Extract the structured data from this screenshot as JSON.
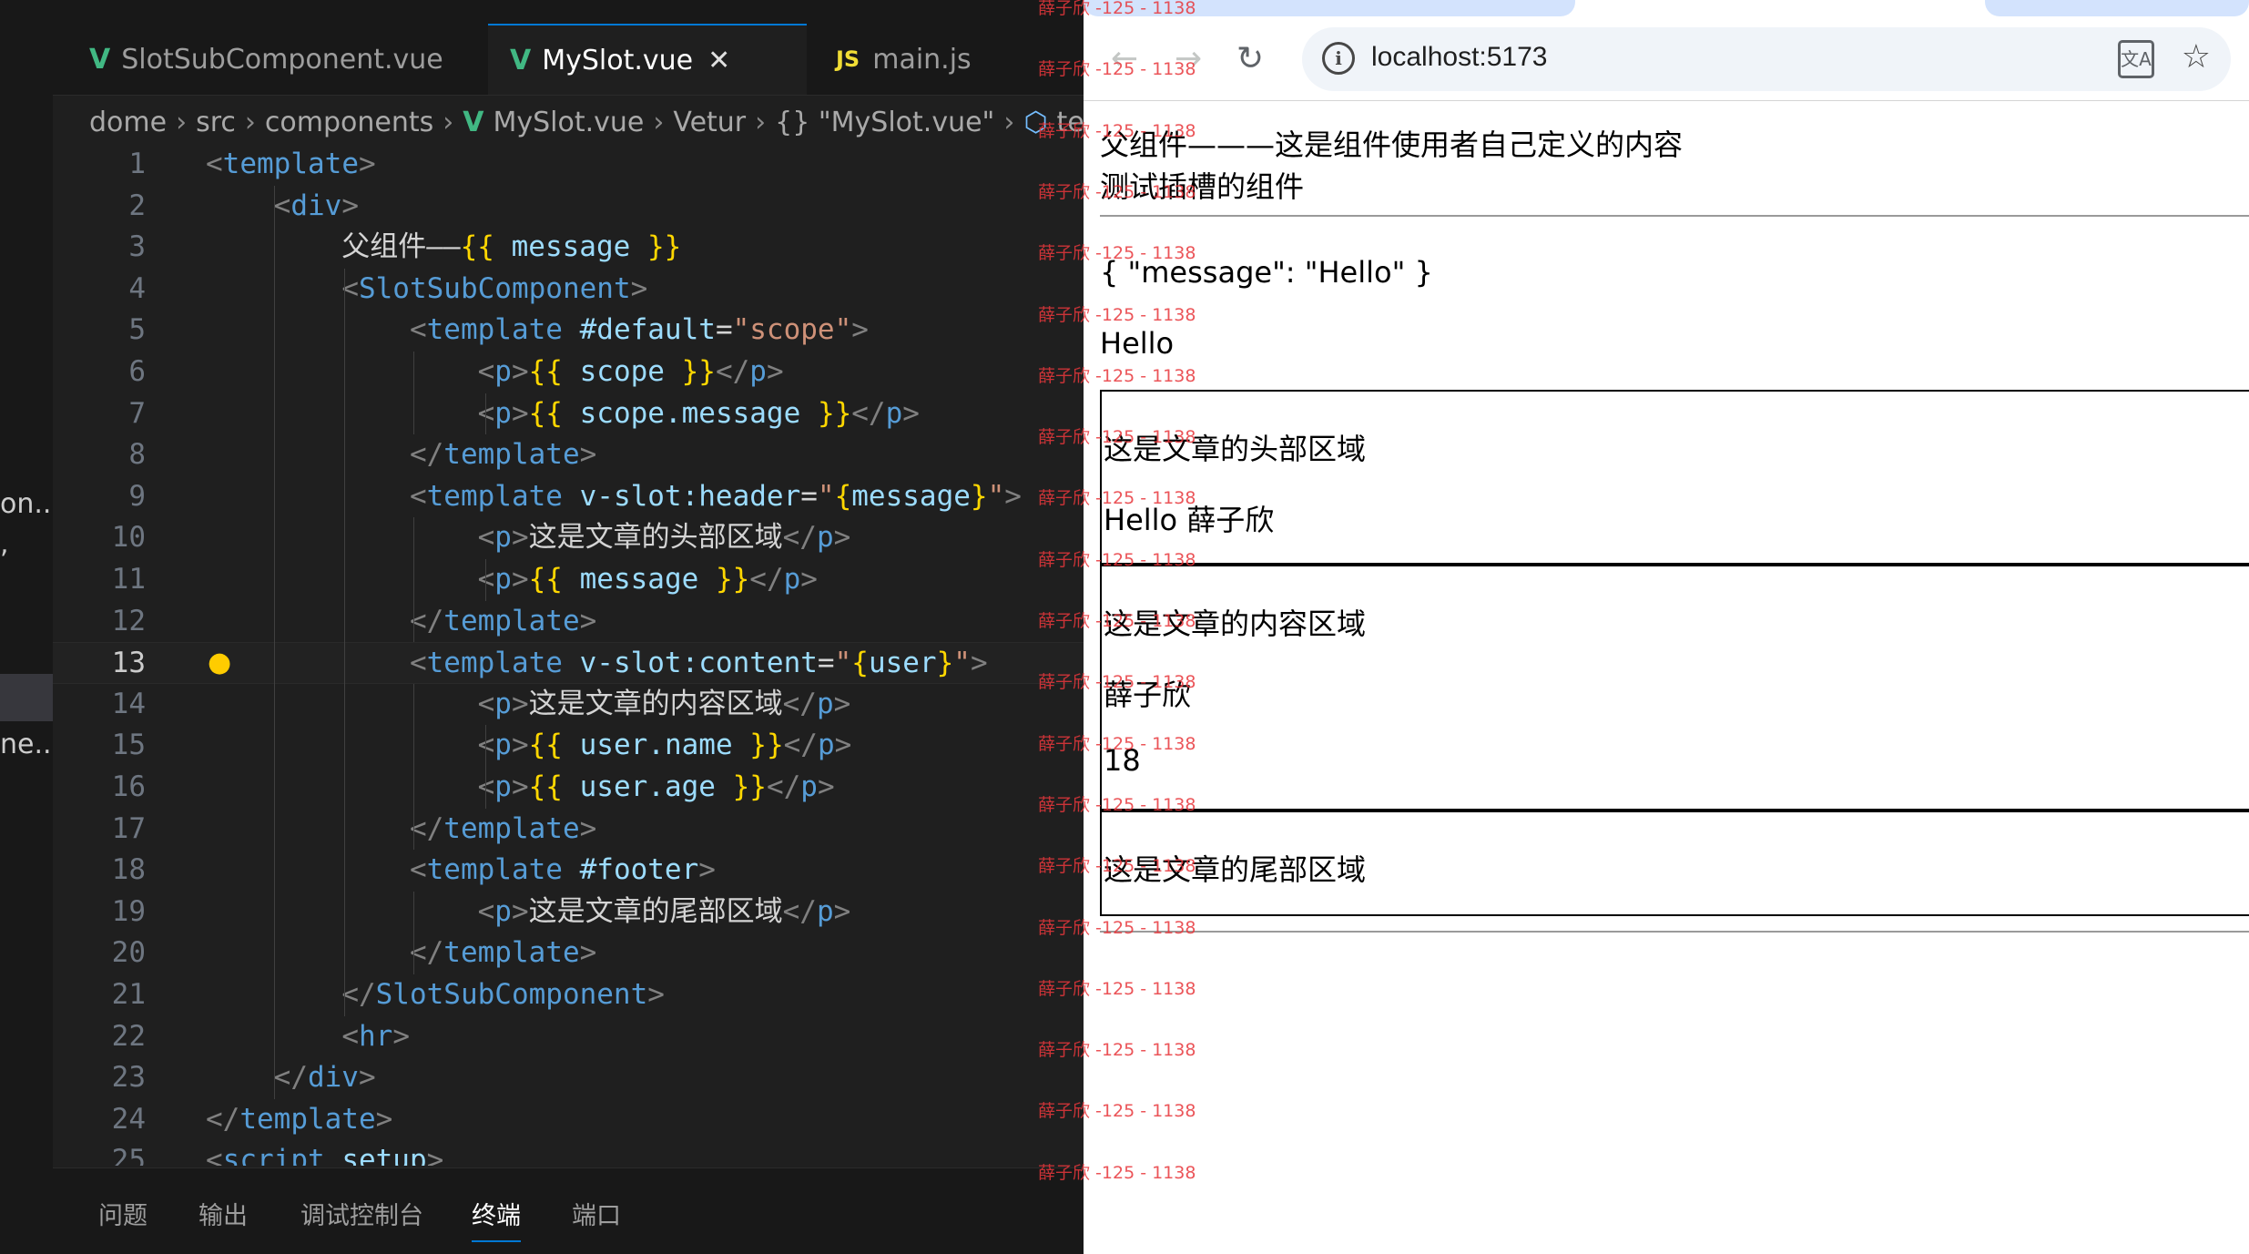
{
  "ide": {
    "activity_fragments": [
      "on...",
      ",",
      "ne..."
    ],
    "tabs": [
      {
        "label": "SlotSubComponent.vue",
        "kind": "vue",
        "active": false
      },
      {
        "label": "MySlot.vue",
        "kind": "vue",
        "active": true
      },
      {
        "label": "main.js",
        "kind": "js",
        "active": false
      }
    ],
    "tab_close_glyph": "✕",
    "breadcrumb": [
      "dome",
      "src",
      "components",
      "MySlot.vue",
      "Vetur",
      "{} \"MySlot.vue\"",
      "te..."
    ],
    "current_line": 13,
    "lines": [
      [
        [
          "p",
          "<"
        ],
        [
          "t",
          "template"
        ],
        [
          "p",
          ">"
        ]
      ],
      [
        [
          "x",
          "    "
        ],
        [
          "p",
          "<"
        ],
        [
          "t",
          "div"
        ],
        [
          "p",
          ">"
        ]
      ],
      [
        [
          "x",
          "        父组件——"
        ],
        [
          "b",
          "{{"
        ],
        [
          "v",
          " message "
        ],
        [
          "b",
          "}}"
        ]
      ],
      [
        [
          "x",
          "        "
        ],
        [
          "p",
          "<"
        ],
        [
          "t",
          "SlotSubComponent"
        ],
        [
          "p",
          ">"
        ]
      ],
      [
        [
          "x",
          "            "
        ],
        [
          "p",
          "<"
        ],
        [
          "t",
          "template"
        ],
        [
          "a",
          " #default"
        ],
        [
          "x",
          "="
        ],
        [
          "s",
          "\"scope\""
        ],
        [
          "p",
          ">"
        ]
      ],
      [
        [
          "x",
          "                "
        ],
        [
          "p",
          "<"
        ],
        [
          "t",
          "p"
        ],
        [
          "p",
          ">"
        ],
        [
          "b",
          "{{"
        ],
        [
          "v",
          " scope "
        ],
        [
          "b",
          "}}"
        ],
        [
          "p",
          "</"
        ],
        [
          "t",
          "p"
        ],
        [
          "p",
          ">"
        ]
      ],
      [
        [
          "x",
          "                "
        ],
        [
          "p",
          "<"
        ],
        [
          "t",
          "p"
        ],
        [
          "p",
          ">"
        ],
        [
          "b",
          "{{"
        ],
        [
          "v",
          " scope.message "
        ],
        [
          "b",
          "}}"
        ],
        [
          "p",
          "</"
        ],
        [
          "t",
          "p"
        ],
        [
          "p",
          ">"
        ]
      ],
      [
        [
          "x",
          "            "
        ],
        [
          "p",
          "</"
        ],
        [
          "t",
          "template"
        ],
        [
          "p",
          ">"
        ]
      ],
      [
        [
          "x",
          "            "
        ],
        [
          "p",
          "<"
        ],
        [
          "t",
          "template"
        ],
        [
          "a",
          " v-slot:header"
        ],
        [
          "x",
          "="
        ],
        [
          "s",
          "\""
        ],
        [
          "b",
          "{"
        ],
        [
          "v",
          "message"
        ],
        [
          "b",
          "}"
        ],
        [
          "s",
          "\""
        ],
        [
          "p",
          ">"
        ]
      ],
      [
        [
          "x",
          "                "
        ],
        [
          "p",
          "<"
        ],
        [
          "t",
          "p"
        ],
        [
          "p",
          ">"
        ],
        [
          "x",
          "这是文章的头部区域"
        ],
        [
          "p",
          "</"
        ],
        [
          "t",
          "p"
        ],
        [
          "p",
          ">"
        ]
      ],
      [
        [
          "x",
          "                "
        ],
        [
          "p",
          "<"
        ],
        [
          "t",
          "p"
        ],
        [
          "p",
          ">"
        ],
        [
          "b",
          "{{"
        ],
        [
          "v",
          " message "
        ],
        [
          "b",
          "}}"
        ],
        [
          "p",
          "</"
        ],
        [
          "t",
          "p"
        ],
        [
          "p",
          ">"
        ]
      ],
      [
        [
          "x",
          "            "
        ],
        [
          "p",
          "</"
        ],
        [
          "t",
          "template"
        ],
        [
          "p",
          ">"
        ]
      ],
      [
        [
          "x",
          "            "
        ],
        [
          "p",
          "<"
        ],
        [
          "t",
          "template"
        ],
        [
          "a",
          " v-slot:content"
        ],
        [
          "x",
          "="
        ],
        [
          "s",
          "\""
        ],
        [
          "b",
          "{"
        ],
        [
          "v",
          "user"
        ],
        [
          "b",
          "}"
        ],
        [
          "s",
          "\""
        ],
        [
          "p",
          ">"
        ]
      ],
      [
        [
          "x",
          "                "
        ],
        [
          "p",
          "<"
        ],
        [
          "t",
          "p"
        ],
        [
          "p",
          ">"
        ],
        [
          "x",
          "这是文章的内容区域"
        ],
        [
          "p",
          "</"
        ],
        [
          "t",
          "p"
        ],
        [
          "p",
          ">"
        ]
      ],
      [
        [
          "x",
          "                "
        ],
        [
          "p",
          "<"
        ],
        [
          "t",
          "p"
        ],
        [
          "p",
          ">"
        ],
        [
          "b",
          "{{"
        ],
        [
          "v",
          " user.name "
        ],
        [
          "b",
          "}}"
        ],
        [
          "p",
          "</"
        ],
        [
          "t",
          "p"
        ],
        [
          "p",
          ">"
        ]
      ],
      [
        [
          "x",
          "                "
        ],
        [
          "p",
          "<"
        ],
        [
          "t",
          "p"
        ],
        [
          "p",
          ">"
        ],
        [
          "b",
          "{{"
        ],
        [
          "v",
          " user.age "
        ],
        [
          "b",
          "}}"
        ],
        [
          "p",
          "</"
        ],
        [
          "t",
          "p"
        ],
        [
          "p",
          ">"
        ]
      ],
      [
        [
          "x",
          "            "
        ],
        [
          "p",
          "</"
        ],
        [
          "t",
          "template"
        ],
        [
          "p",
          ">"
        ]
      ],
      [
        [
          "x",
          "            "
        ],
        [
          "p",
          "<"
        ],
        [
          "t",
          "template"
        ],
        [
          "a",
          " #footer"
        ],
        [
          "p",
          ">"
        ]
      ],
      [
        [
          "x",
          "                "
        ],
        [
          "p",
          "<"
        ],
        [
          "t",
          "p"
        ],
        [
          "p",
          ">"
        ],
        [
          "x",
          "这是文章的尾部区域"
        ],
        [
          "p",
          "</"
        ],
        [
          "t",
          "p"
        ],
        [
          "p",
          ">"
        ]
      ],
      [
        [
          "x",
          "            "
        ],
        [
          "p",
          "</"
        ],
        [
          "t",
          "template"
        ],
        [
          "p",
          ">"
        ]
      ],
      [
        [
          "x",
          "        "
        ],
        [
          "p",
          "</"
        ],
        [
          "t",
          "SlotSubComponent"
        ],
        [
          "p",
          ">"
        ]
      ],
      [
        [
          "x",
          "        "
        ],
        [
          "p",
          "<"
        ],
        [
          "t",
          "hr"
        ],
        [
          "p",
          ">"
        ]
      ],
      [
        [
          "x",
          "    "
        ],
        [
          "p",
          "</"
        ],
        [
          "t",
          "div"
        ],
        [
          "p",
          ">"
        ]
      ],
      [
        [
          "p",
          "</"
        ],
        [
          "t",
          "template"
        ],
        [
          "p",
          ">"
        ]
      ],
      [
        [
          "p",
          "<"
        ],
        [
          "t",
          "script"
        ],
        [
          "a",
          " setup"
        ],
        [
          "p",
          ">"
        ]
      ]
    ],
    "panel_tabs": [
      {
        "label": "问题",
        "active": false
      },
      {
        "label": "输出",
        "active": false
      },
      {
        "label": "调试控制台",
        "active": false
      },
      {
        "label": "终端",
        "active": true
      },
      {
        "label": "端口",
        "active": false
      }
    ]
  },
  "browser": {
    "url": "localhost:5173",
    "translate_glyph": "文A",
    "bookmark_glyph": "☆",
    "content": {
      "title": "父组件———这是组件使用者自己定义的内容",
      "subtitle": "测试插槽的组件",
      "scope_json": "{ \"message\": \"Hello\" }",
      "scope_message": "Hello",
      "header_title": "这是文章的头部区域",
      "header_message": "Hello 薛子欣",
      "content_title": "这是文章的内容区域",
      "user_name": "薛子欣",
      "user_age": "18",
      "footer_title": "这是文章的尾部区域"
    }
  },
  "watermark": "薛子欣 -125 - 1138"
}
